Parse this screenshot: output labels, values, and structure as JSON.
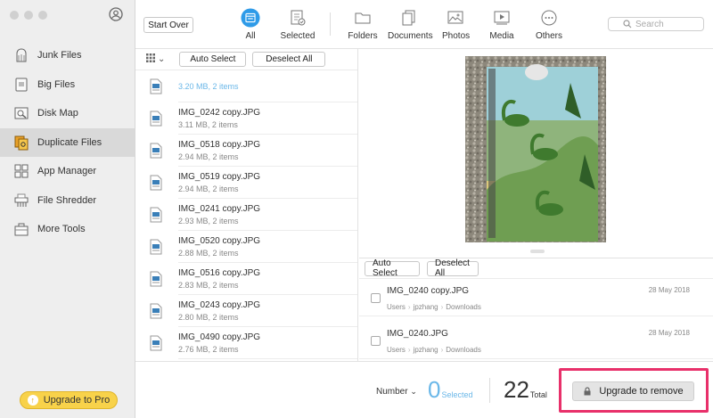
{
  "sidebar": {
    "items": [
      {
        "label": "Junk Files",
        "icon": "broom-icon"
      },
      {
        "label": "Big Files",
        "icon": "big-files-icon"
      },
      {
        "label": "Disk Map",
        "icon": "disk-map-icon"
      },
      {
        "label": "Duplicate Files",
        "icon": "duplicate-files-icon",
        "active": true
      },
      {
        "label": "App Manager",
        "icon": "app-manager-icon"
      },
      {
        "label": "File Shredder",
        "icon": "shredder-icon"
      },
      {
        "label": "More Tools",
        "icon": "toolbox-icon"
      }
    ],
    "upgrade_label": "Upgrade to Pro"
  },
  "toolbar": {
    "start_over": "Start Over",
    "tabs": {
      "all": "All",
      "selected": "Selected",
      "folders": "Folders",
      "documents": "Documents",
      "photos": "Photos",
      "media": "Media",
      "others": "Others"
    },
    "search_placeholder": "Search"
  },
  "list": {
    "auto_select": "Auto Select",
    "deselect_all": "Deselect All",
    "group_summary": "3.20 MB, 2 items",
    "files": [
      {
        "name": "IMG_0242 copy.JPG",
        "meta": "3.11 MB, 2 items"
      },
      {
        "name": "IMG_0518 copy.JPG",
        "meta": "2.94 MB, 2 items"
      },
      {
        "name": "IMG_0519 copy.JPG",
        "meta": "2.94 MB, 2 items"
      },
      {
        "name": "IMG_0241 copy.JPG",
        "meta": "2.93 MB, 2 items"
      },
      {
        "name": "IMG_0520 copy.JPG",
        "meta": "2.88 MB, 2 items"
      },
      {
        "name": "IMG_0516 copy.JPG",
        "meta": "2.83 MB, 2 items"
      },
      {
        "name": "IMG_0243 copy.JPG",
        "meta": "2.80 MB, 2 items"
      },
      {
        "name": "IMG_0490 copy.JPG",
        "meta": "2.76 MB, 2 items"
      }
    ]
  },
  "detail": {
    "auto_select": "Auto Select",
    "deselect_all": "Deselect All",
    "items": [
      {
        "name": "IMG_0240 copy.JPG",
        "date": "28 May 2018",
        "path": [
          "Users",
          "jpzhang",
          "Downloads"
        ]
      },
      {
        "name": "IMG_0240.JPG",
        "date": "28 May 2018",
        "path": [
          "Users",
          "jpzhang",
          "Downloads"
        ]
      }
    ]
  },
  "bottom": {
    "sort_label": "Number",
    "selected_count": "0",
    "selected_label": "Selected",
    "total_count": "22",
    "total_label": "Total",
    "upgrade_remove": "Upgrade to remove"
  },
  "colors": {
    "accent_blue": "#2f9be8",
    "highlight_pink": "#e8306a",
    "pro_yellow": "#f8d24a"
  }
}
